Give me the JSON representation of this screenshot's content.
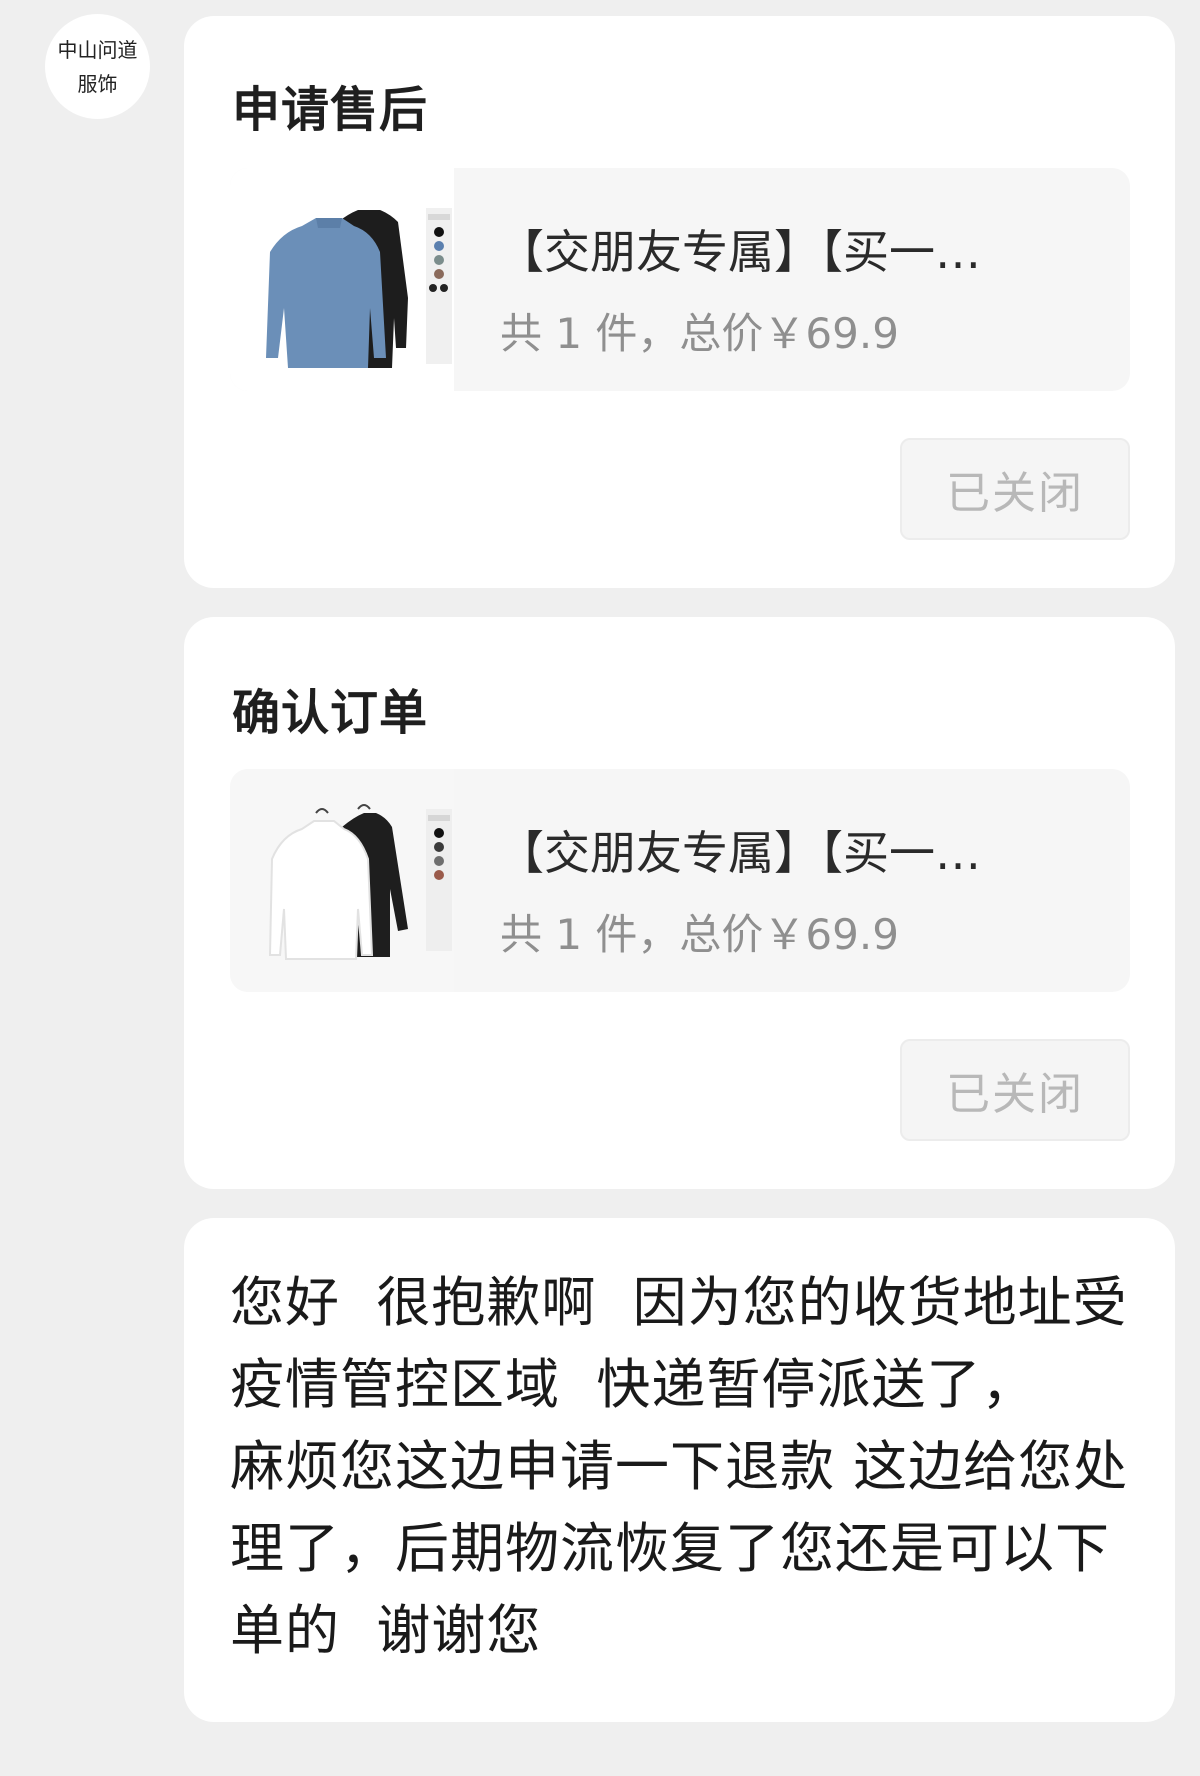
{
  "sender": {
    "avatar_line1": "中山问道",
    "avatar_line2": "服饰"
  },
  "messages": [
    {
      "title": "申请售后",
      "product": {
        "name": "【交朋友专属】【买一…",
        "summary": "共 1 件，总价￥69.9",
        "thumbnail": "blue-and-black-turtleneck-shirts"
      },
      "status_label": "已关闭"
    },
    {
      "title": "确认订单",
      "product": {
        "name": "【交朋友专属】【买一…",
        "summary": "共 1 件，总价￥69.9",
        "thumbnail": "white-and-black-turtleneck-shirts"
      },
      "status_label": "已关闭"
    }
  ],
  "text_message": "您好  很抱歉啊  因为您的收货地址受疫情管控区域  快递暂停派送了，   麻烦您这边申请一下退款 这边给您处理了，后期物流恢复了您还是可以下单的  谢谢您",
  "colors": {
    "background": "#efefef",
    "card": "#ffffff",
    "product_bg": "#f6f6f6",
    "muted_text": "#8f8f8f",
    "closed_text": "#b8b8b8"
  }
}
